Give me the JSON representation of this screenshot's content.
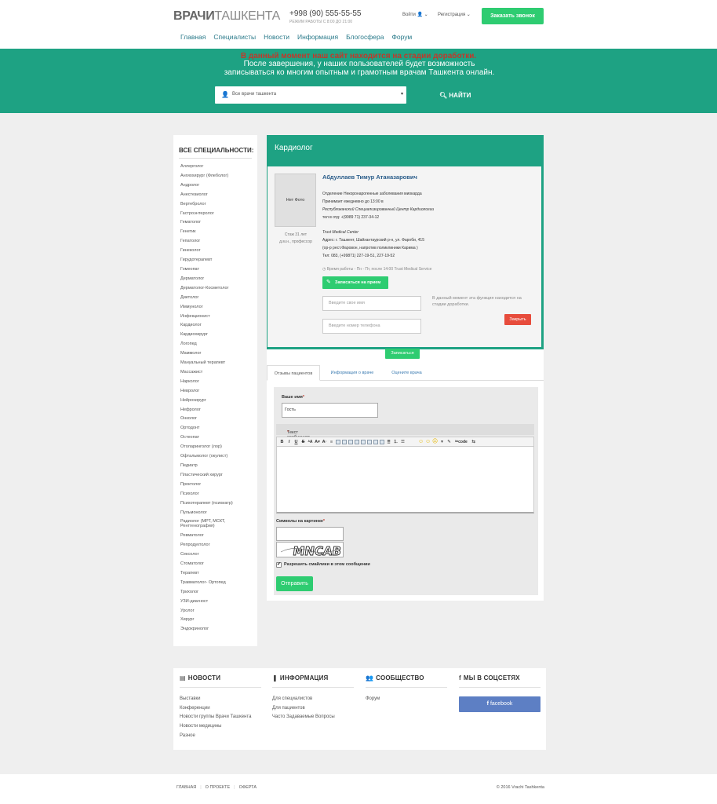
{
  "header": {
    "logo_bold": "ВРАЧИ",
    "logo_light": "ТАШКЕНТА",
    "phone": "+998 (90) 555-55-55",
    "hours": "РЕЖИМ РАБОТЫ С 8:00 ДО 21:00",
    "login": "Войти",
    "register": "Регистрация",
    "call_button": "Заказать звонок"
  },
  "nav": [
    "Главная",
    "Специалисты",
    "Новости",
    "Информация",
    "Блогосфера",
    "Форум"
  ],
  "banner": {
    "alert": "В данный момент наш сайт находится на стадии доработки.",
    "line1": "После завершения, у наших пользователей будет возможность",
    "line2": "записываться ко многим опытным и грамотным врачам Ташкента онлайн.",
    "select_placeholder": "Все врачи ташкента",
    "search_button": "НАЙТИ"
  },
  "sidebar": {
    "title": "ВСЕ СПЕЦИАЛЬНОСТИ:",
    "items": [
      "Аллерголог",
      "Ангиохирург (Флеболог)",
      "Андролог",
      "Анестезиолог",
      "Вертебролог",
      "Гастроэнтеролог",
      "Гематолог",
      "Генетик",
      "Гепатолог",
      "Гинеколог",
      "Гирудотерапевт",
      "Гомеопат",
      "Дерматолог",
      "Дерматолог-Косметолог",
      "Диетолог",
      "Иммунолог",
      "Инфекционист",
      "Кардиолог",
      "Кардиохирург",
      "Логопед",
      "Маммолог",
      "Мануальный терапевт",
      "Массажист",
      "Нарколог",
      "Невролог",
      "Нейрохирург",
      "Нефролог",
      "Онколог",
      "Ортодонт",
      "Остеопат",
      "Отоларинголог (лор)",
      "Офтальмолог (окулист)",
      "Педиатр",
      "Пластический хирург",
      "Проктолог",
      "Психолог",
      "Психотерапевт (психиатр)",
      "Пульмонолог",
      "Радиолог (МРТ, МСКТ, Рентгенография)",
      "Ревматолог",
      "Репродуктолог",
      "Сексолог",
      "Стоматолог",
      "Терапевт",
      "Травматолог- Ортопед",
      "Трихолог",
      "УЗИ-диагност",
      "Уролог",
      "Хирург",
      "Эндокринолог"
    ]
  },
  "card": {
    "title": "Кардиолог",
    "doctor_name": "Абдуллаев Тимур Атаназарович",
    "photo_placeholder": "Нет Фото",
    "experience": "Стаж 31 лет",
    "degree": "д.м.н., профессор",
    "dept": "Отделение Некоронарогенные заболевания миокарда",
    "receives": "Принимает ежедневно до 13:00 в",
    "center": "Республиканский Специализированный Центр Кардиологии",
    "phone1": "тел в отд: +(9989 71) 237-34-12",
    "clinic": "Trust Medical Center",
    "address": "Адрес: г. Ташкент, Шайхантаурский р-н, ул. Фароби, 415",
    "landmark": "(ор-р рест.Фаровон, напротив поликлиники Карима )",
    "phone2": "Тел:   083, (+99871) 227-19-51, 227-19-52",
    "worktime": "Время работы - Пн - Пт, после 14:00 Trust Medical Service",
    "appointment_button": "Записаться на прием",
    "name_placeholder": "Введите свое имя",
    "phone_placeholder": "Введите номер телефона",
    "dev_note": "В данный момент эта функция находится на стадии доработки.",
    "close_button": "Закрыть",
    "signup_button": "Записаться"
  },
  "tabs": [
    "Отзывы пациентов",
    "Информация о враче",
    "Оцените врача"
  ],
  "form": {
    "name_label": "Ваше имя",
    "name_value": "Гость",
    "message_label": "Текст сообщения",
    "captcha_label": "Символы на картинке",
    "captcha_text": "MNCAB",
    "smiley_label": "Разрешить смайлики в этом сообщении",
    "submit_button": "Отправить"
  },
  "footer": {
    "news": {
      "title": "НОВОСТИ",
      "links": [
        "Выставки",
        "Конференции",
        "Новости группы Врачи Ташкента",
        "Новости медицины",
        "Разное"
      ]
    },
    "info": {
      "title": "ИНФОРМАЦИЯ",
      "links": [
        "Для специалистов",
        "Для пациентов",
        "Часто Задаваемые Вопросы"
      ]
    },
    "community": {
      "title": "СООБЩЕСТВО",
      "links": [
        "Форум"
      ]
    },
    "social": {
      "title": "МЫ В СОЦСЕТЯХ",
      "facebook": "facebook"
    }
  },
  "bottombar": {
    "links": [
      "ГЛАВНАЯ",
      "О ПРОЕКТЕ",
      "ОФЕРТА"
    ],
    "copyright": "© 2016 Vrachi Tashkenta"
  },
  "colors": {
    "accent": "#1ea283",
    "button_green": "#2ecc71",
    "alert_red": "#c0392b",
    "close_red": "#e74c3c",
    "facebook": "#5d7fc4"
  }
}
